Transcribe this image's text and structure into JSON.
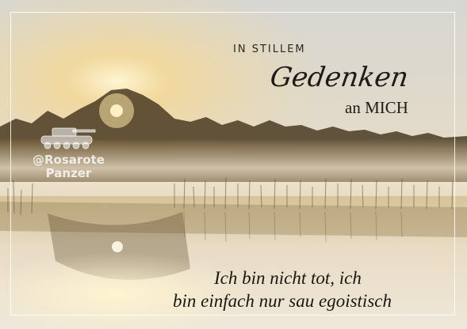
{
  "card": {
    "heading_small": "IN STILLEM",
    "heading_script": "Gedenken",
    "heading_tail": "an MICH",
    "quote_line1": "Ich bin nicht tot, ich",
    "quote_line2": "bin einfach nur sau egoistisch"
  },
  "watermark": {
    "line1": "@Rosarote",
    "line2": "Panzer",
    "icon": "tank-icon"
  },
  "colors": {
    "sky_top": "#d9d7d1",
    "sun_glow": "#fff3c8",
    "forest": "#3a2e1c",
    "water": "#e8ddc8"
  }
}
